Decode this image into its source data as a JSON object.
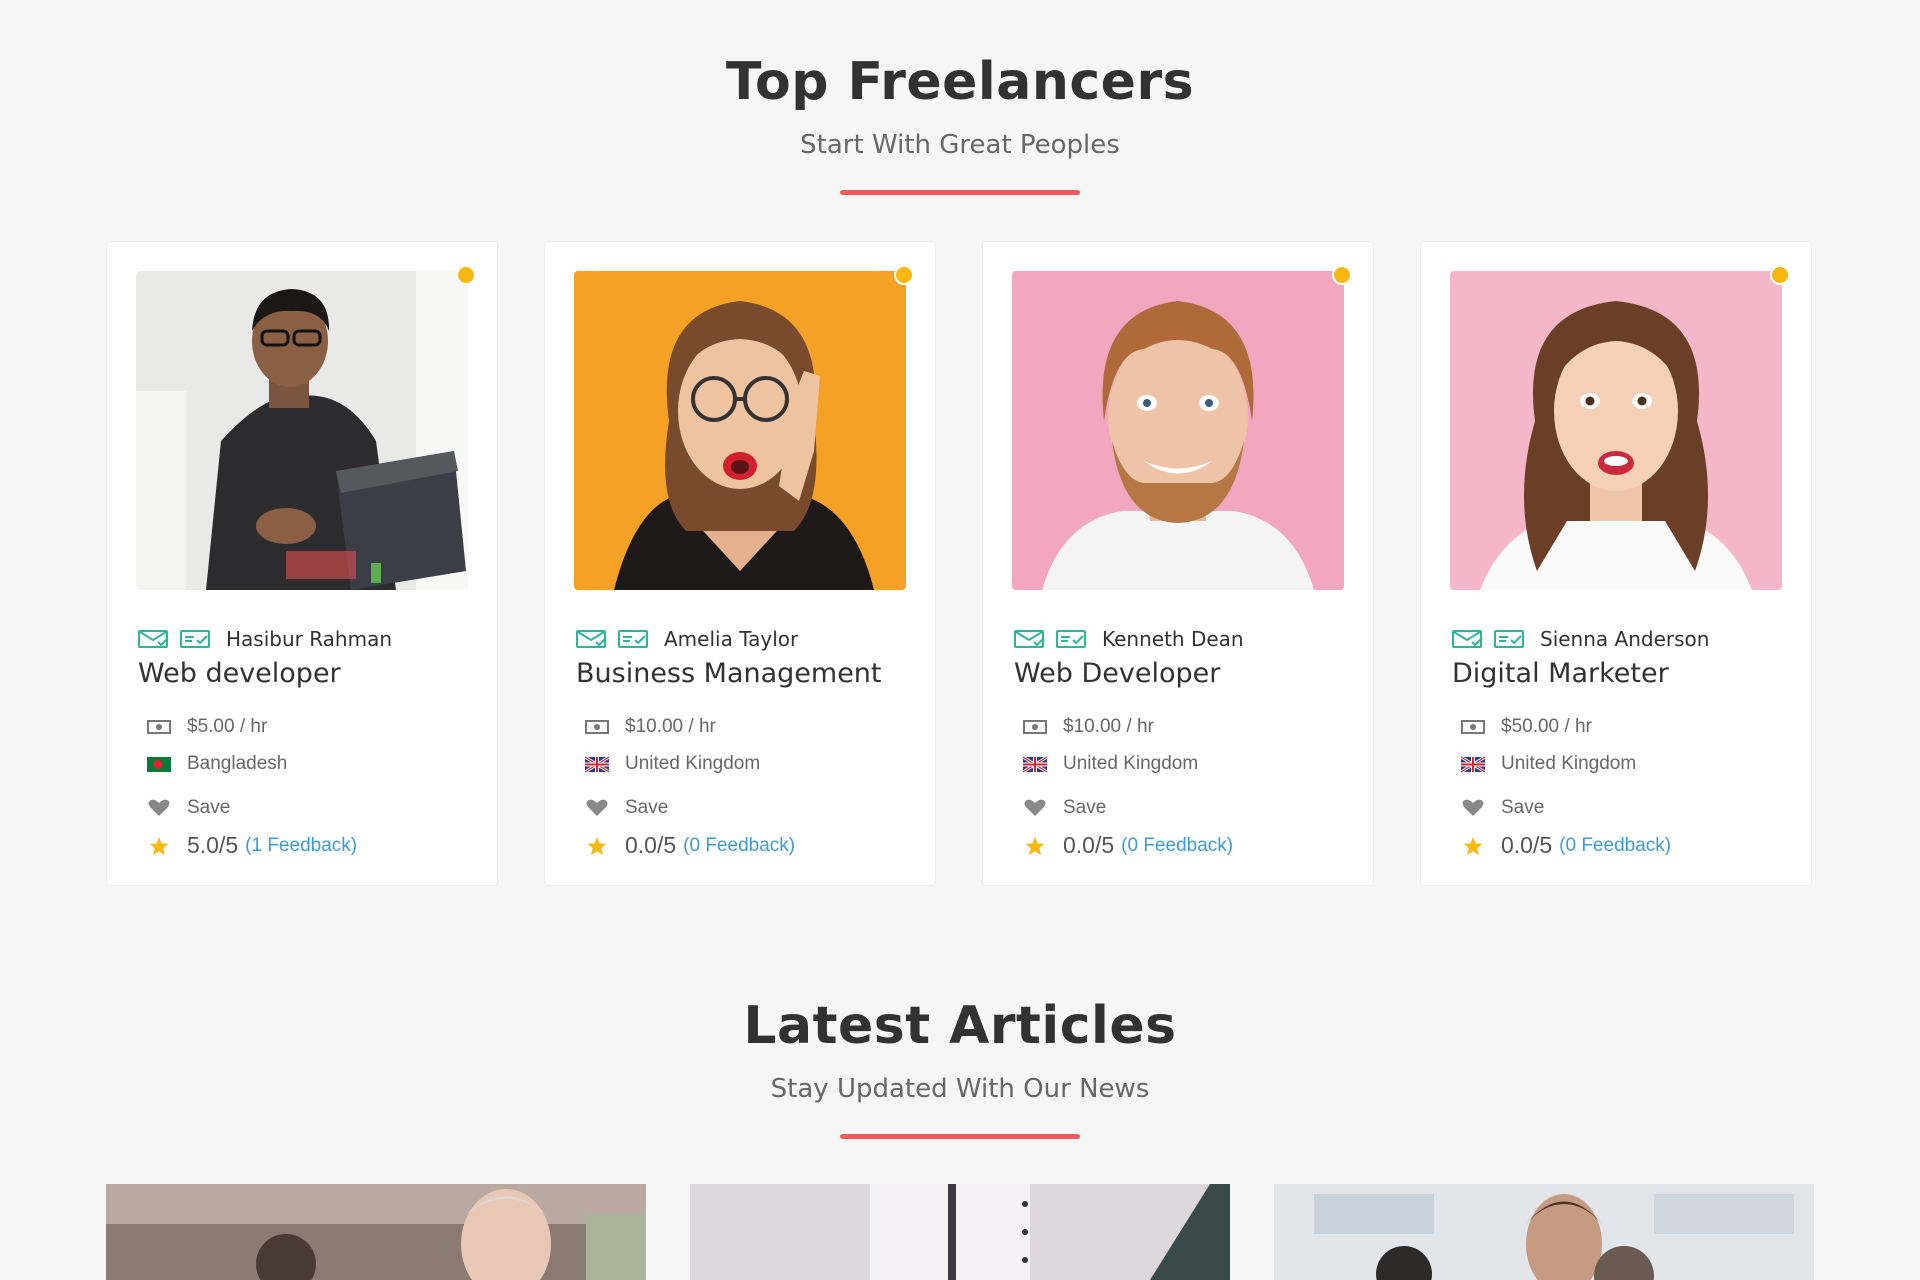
{
  "top_freelancers": {
    "title": "Top Freelancers",
    "subtitle": "Start With Great Peoples",
    "accent_color": "#f2575b",
    "online_color": "#f9b811",
    "cards": [
      {
        "name": "Hasibur Rahman",
        "role": "Web developer",
        "rate": "$5.00 / hr",
        "country": "Bangladesh",
        "save_label": "Save",
        "rating": "5.0/5",
        "feedback": "(1 Feedback)",
        "flag": "bangladesh-flag-icon"
      },
      {
        "name": "Amelia Taylor",
        "role": "Business Management",
        "rate": "$10.00 / hr",
        "country": "United Kingdom",
        "save_label": "Save",
        "rating": "0.0/5",
        "feedback": "(0 Feedback)",
        "flag": "uk-flag-icon"
      },
      {
        "name": "Kenneth Dean",
        "role": "Web Developer",
        "rate": "$10.00 / hr",
        "country": "United Kingdom",
        "save_label": "Save",
        "rating": "0.0/5",
        "feedback": "(0 Feedback)",
        "flag": "uk-flag-icon"
      },
      {
        "name": "Sienna Anderson",
        "role": "Digital Marketer",
        "rate": "$50.00 / hr",
        "country": "United Kingdom",
        "save_label": "Save",
        "rating": "0.0/5",
        "feedback": "(0 Feedback)",
        "flag": "uk-flag-icon"
      }
    ]
  },
  "latest_articles": {
    "title": "Latest Articles",
    "subtitle": "Stay Updated With Our News"
  }
}
